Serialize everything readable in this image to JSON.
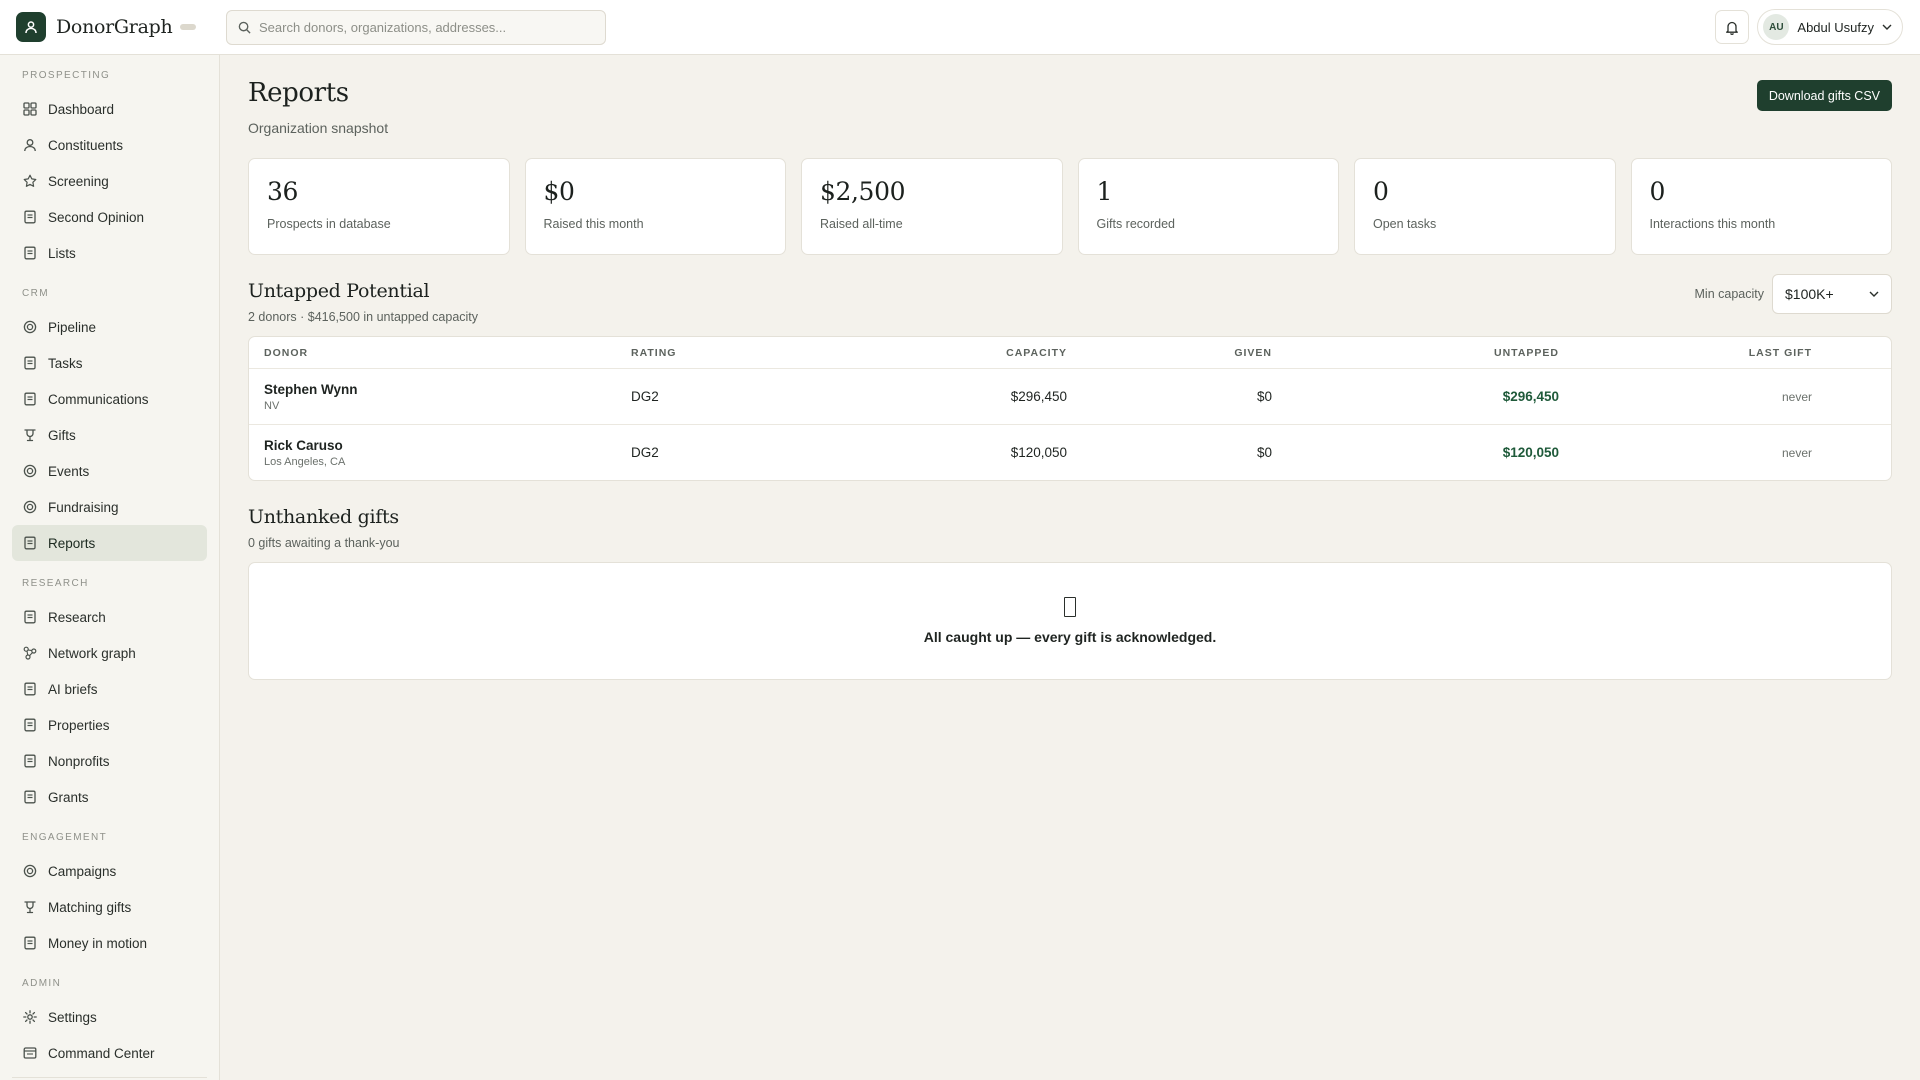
{
  "app": {
    "name": "DonorGraph",
    "search_placeholder": "Search donors, organizations, addresses...",
    "user": {
      "initials": "AU",
      "name": "Abdul Usufzy"
    }
  },
  "sidebar": {
    "sections": [
      {
        "label": "PROSPECTING",
        "items": [
          {
            "label": "Dashboard",
            "icon": "grid-icon"
          },
          {
            "label": "Constituents",
            "icon": "person-icon"
          },
          {
            "label": "Screening",
            "icon": "star-icon"
          },
          {
            "label": "Second Opinion",
            "icon": "doc-icon"
          },
          {
            "label": "Lists",
            "icon": "doc-icon"
          }
        ]
      },
      {
        "label": "CRM",
        "items": [
          {
            "label": "Pipeline",
            "icon": "target-icon"
          },
          {
            "label": "Tasks",
            "icon": "doc-icon"
          },
          {
            "label": "Communications",
            "icon": "doc-icon"
          },
          {
            "label": "Gifts",
            "icon": "trophy-icon"
          },
          {
            "label": "Events",
            "icon": "target-icon"
          },
          {
            "label": "Fundraising",
            "icon": "target-icon"
          },
          {
            "label": "Reports",
            "icon": "doc-icon",
            "active": true
          }
        ]
      },
      {
        "label": "RESEARCH",
        "items": [
          {
            "label": "Research",
            "icon": "doc-icon"
          },
          {
            "label": "Network graph",
            "icon": "network-icon"
          },
          {
            "label": "AI briefs",
            "icon": "doc-icon"
          },
          {
            "label": "Properties",
            "icon": "doc-icon"
          },
          {
            "label": "Nonprofits",
            "icon": "doc-icon"
          },
          {
            "label": "Grants",
            "icon": "doc-icon"
          }
        ]
      },
      {
        "label": "ENGAGEMENT",
        "items": [
          {
            "label": "Campaigns",
            "icon": "target-icon"
          },
          {
            "label": "Matching gifts",
            "icon": "trophy-icon"
          },
          {
            "label": "Money in motion",
            "icon": "doc-icon"
          }
        ]
      },
      {
        "label": "ADMIN",
        "items": [
          {
            "label": "Settings",
            "icon": "gear-icon"
          },
          {
            "label": "Command Center",
            "icon": "window-icon"
          }
        ]
      }
    ]
  },
  "page": {
    "title": "Reports",
    "subtitle": "Organization snapshot",
    "download_label": "Download gifts CSV"
  },
  "stats": [
    {
      "value": "36",
      "label": "Prospects in database"
    },
    {
      "value": "$0",
      "label": "Raised this month"
    },
    {
      "value": "$2,500",
      "label": "Raised all-time"
    },
    {
      "value": "1",
      "label": "Gifts recorded"
    },
    {
      "value": "0",
      "label": "Open tasks"
    },
    {
      "value": "0",
      "label": "Interactions this month"
    }
  ],
  "untapped": {
    "title": "Untapped Potential",
    "subtitle": "2 donors · $416,500 in untapped capacity",
    "filter_label": "Min capacity",
    "filter_value": "$100K+",
    "columns": [
      "DONOR",
      "RATING",
      "CAPACITY",
      "GIVEN",
      "UNTAPPED",
      "LAST GIFT"
    ],
    "rows": [
      {
        "name": "Stephen Wynn",
        "location": "NV",
        "rating": "DG2",
        "capacity": "$296,450",
        "given": "$0",
        "untapped": "$296,450",
        "last_gift": "never"
      },
      {
        "name": "Rick Caruso",
        "location": "Los Angeles, CA",
        "rating": "DG2",
        "capacity": "$120,050",
        "given": "$0",
        "untapped": "$120,050",
        "last_gift": "never"
      }
    ]
  },
  "unthanked": {
    "title": "Unthanked gifts",
    "subtitle": "0 gifts awaiting a thank-you",
    "empty_message": "All caught up — every gift is acknowledged.",
    "empty_icon": "missing-glyph-icon"
  },
  "colors": {
    "brand": "#1f3f2e",
    "background": "#f4f2ec",
    "untapped_text": "#1f5a3a",
    "active_nav": "#e3e6dc"
  }
}
